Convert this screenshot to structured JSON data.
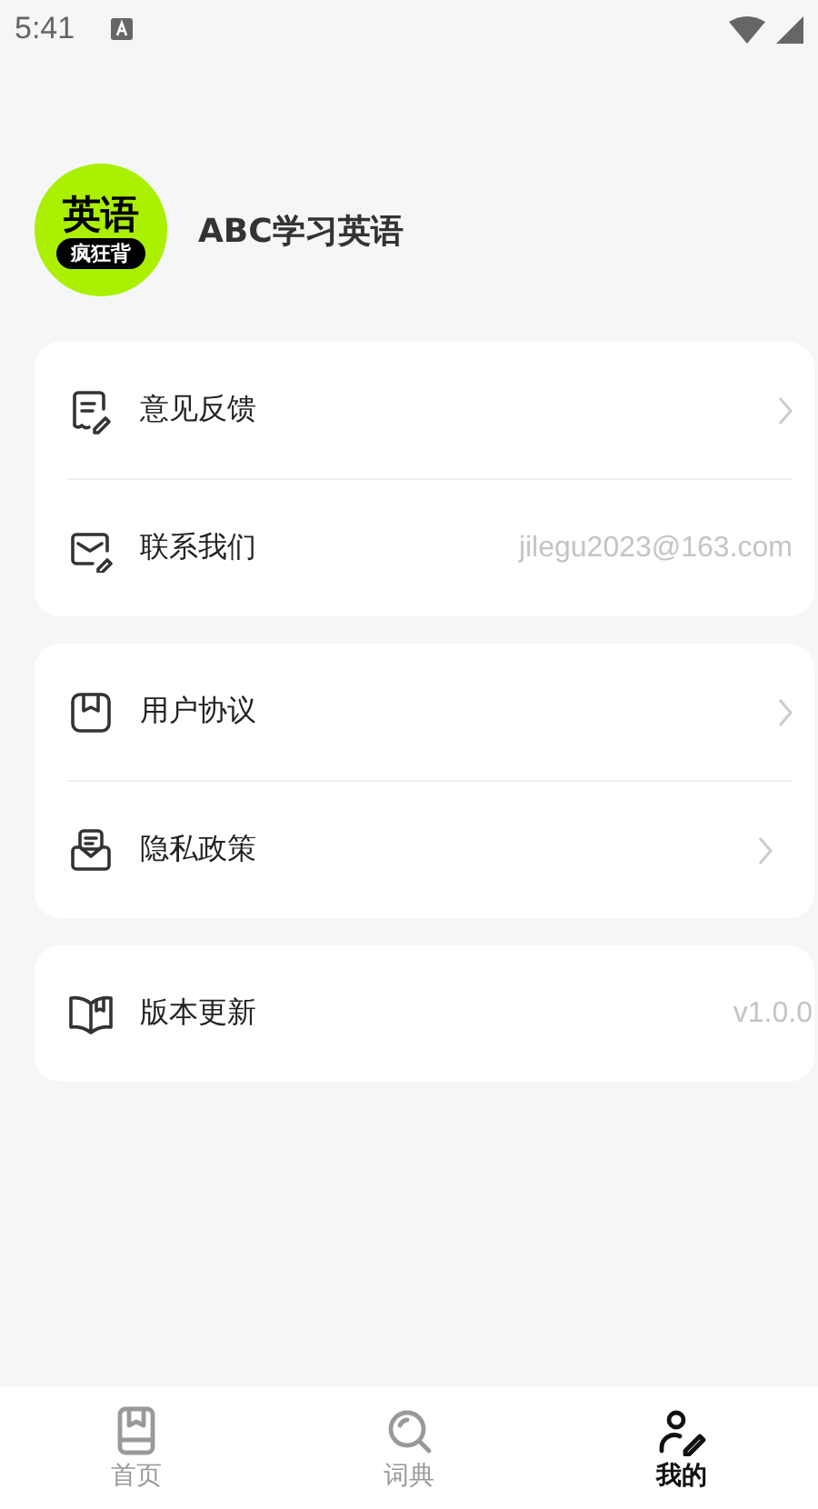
{
  "status_bar": {
    "time": "5:41"
  },
  "profile": {
    "logo_top": "英语",
    "logo_bottom": "疯狂背",
    "name": "ABC学习英语"
  },
  "groups": [
    {
      "items": [
        {
          "label": "意见反馈",
          "kind": "link"
        },
        {
          "label": "联系我们",
          "kind": "value",
          "value": "jilegu2023@163.com"
        }
      ]
    },
    {
      "items": [
        {
          "label": "用户协议",
          "kind": "link"
        },
        {
          "label": "隐私政策",
          "kind": "link"
        }
      ]
    },
    {
      "items": [
        {
          "label": "版本更新",
          "kind": "value",
          "value": "v1.0.0"
        }
      ]
    }
  ],
  "tabs": [
    {
      "label": "首页",
      "selected": false
    },
    {
      "label": "词典",
      "selected": false
    },
    {
      "label": "我的",
      "selected": true
    }
  ]
}
